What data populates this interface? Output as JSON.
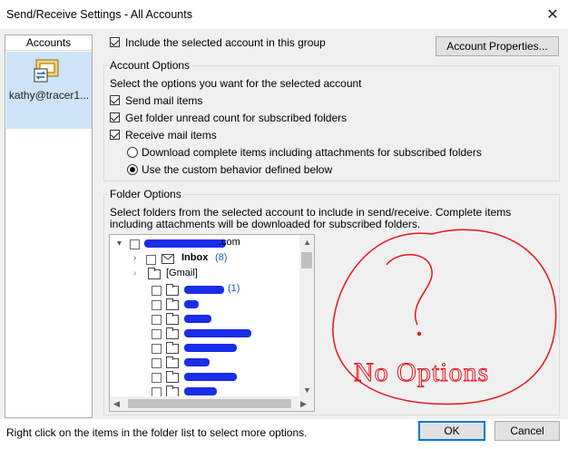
{
  "window": {
    "title": "Send/Receive Settings - All Accounts"
  },
  "accounts": {
    "header": "Accounts",
    "items": [
      {
        "label": "kathy@tracer1...",
        "icon": "account-sync-icon"
      }
    ]
  },
  "include_account": {
    "label": "Include the selected account in this group",
    "checked": true
  },
  "account_properties_button": "Account Properties...",
  "account_options": {
    "title": "Account Options",
    "instruction": "Select the options you want for the selected account",
    "send_mail": {
      "label": "Send mail items",
      "checked": true
    },
    "get_unread": {
      "label": "Get folder unread count for subscribed folders",
      "checked": true
    },
    "receive_mail": {
      "label": "Receive mail items",
      "checked": true
    },
    "radio_download": {
      "label": "Download complete items including attachments for subscribed folders",
      "selected": false
    },
    "radio_custom": {
      "label": "Use the custom behavior defined below",
      "selected": true
    }
  },
  "folder_options": {
    "title": "Folder Options",
    "description": "Select folders from the selected account to include in send/receive. Complete items including attachments will be downloaded for subscribed folders.",
    "tree": {
      "root_suffix": ".com",
      "inbox": {
        "label": "Inbox",
        "count": "(8)"
      },
      "gmail": {
        "label": "[Gmail]"
      },
      "first_subfolder_count": "(1)"
    }
  },
  "annotation": {
    "text": "No Options",
    "color": "#e8141c"
  },
  "footer": {
    "hint": "Right click on the items in the folder list to select more options.",
    "ok": "OK",
    "cancel": "Cancel"
  },
  "colors": {
    "selection": "#cde3f7",
    "accent": "#0078d7",
    "redaction": "#1a2de8"
  }
}
